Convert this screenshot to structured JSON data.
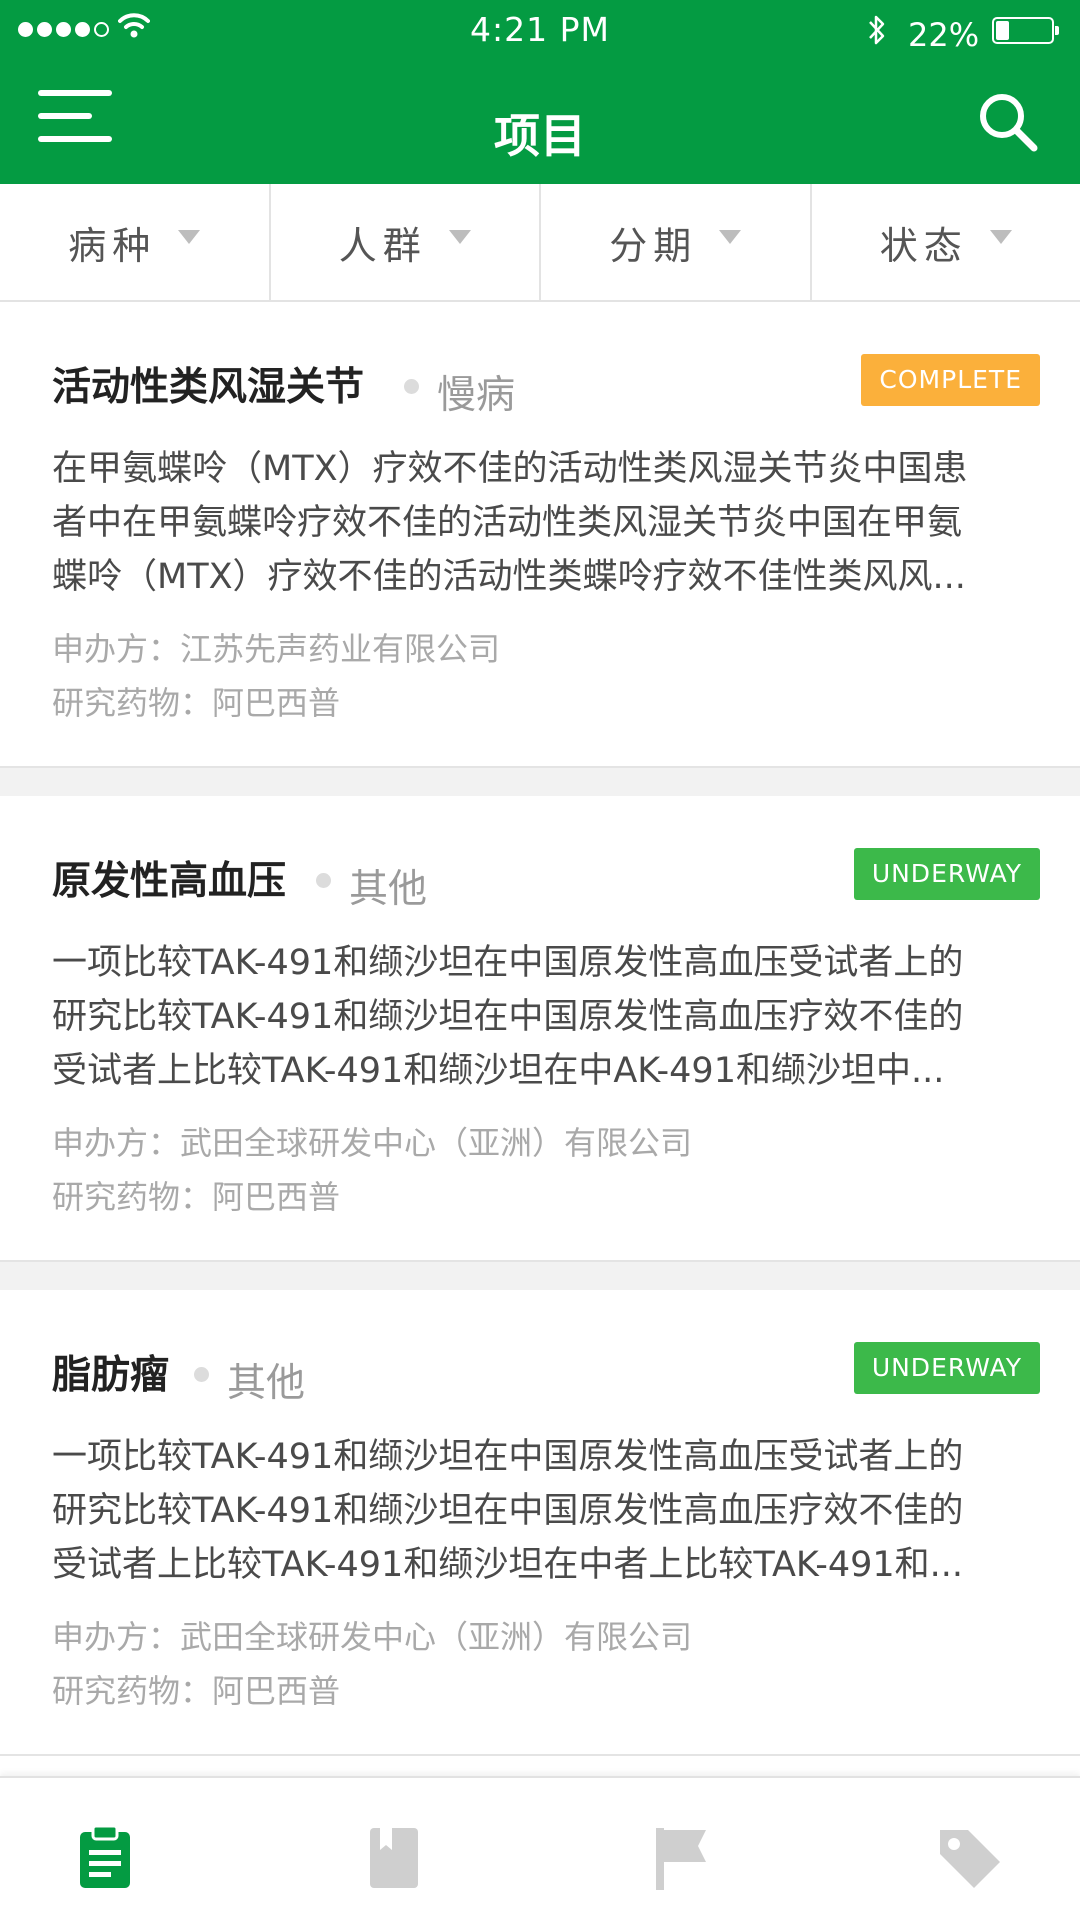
{
  "status_bar": {
    "time": "4:21 PM",
    "battery": "22%"
  },
  "header": {
    "title": "项目"
  },
  "filters": [
    "病种",
    "人群",
    "分期",
    "状态"
  ],
  "projects": [
    {
      "title": "活动性类风湿关节",
      "category": "慢病",
      "status": "COMPLETE",
      "status_color": "#fbb03b",
      "description": [
        "在甲氨蝶呤（MTX）疗效不佳的活动性类风湿关节炎中国患",
        "者中在甲氨蝶呤疗效不佳的活动性类风湿关节炎中国在甲氨",
        "蝶呤（MTX）疗效不佳的活动性类蝶呤疗效不佳性类风风..."
      ],
      "sponsor": "申办方：江苏先声药业有限公司",
      "drug": "研究药物：阿巴西普"
    },
    {
      "title": "原发性高血压",
      "category": "其他",
      "status": "UNDERWAY",
      "status_color": "#3cb94a",
      "description": [
        "一项比较TAK-491和缬沙坦在中国原发性高血压受试者上的",
        "研究比较TAK-491和缬沙坦在中国原发性高血压疗效不佳的",
        "受试者上比较TAK-491和缬沙坦在中AK-491和缬沙坦中..."
      ],
      "sponsor": "申办方：武田全球研发中心（亚洲）有限公司",
      "drug": "研究药物：阿巴西普"
    },
    {
      "title": "脂肪瘤",
      "category": "其他",
      "status": "UNDERWAY",
      "status_color": "#3cb94a",
      "description": [
        "一项比较TAK-491和缬沙坦在中国原发性高血压受试者上的",
        "研究比较TAK-491和缬沙坦在中国原发性高血压疗效不佳的",
        "受试者上比较TAK-491和缬沙坦在中者上比较TAK-491和..."
      ],
      "sponsor": "申办方：武田全球研发中心（亚洲）有限公司",
      "drug": "研究药物：阿巴西普"
    }
  ],
  "tabbar": {
    "items": [
      {
        "icon": "clipboard-icon",
        "active": true
      },
      {
        "icon": "book-icon",
        "active": false
      },
      {
        "icon": "flag-icon",
        "active": false
      },
      {
        "icon": "tag-icon",
        "active": false
      }
    ],
    "active_color": "#049b42",
    "inactive_color": "#cfcfcf"
  },
  "colors": {
    "brand": "#049b42"
  }
}
